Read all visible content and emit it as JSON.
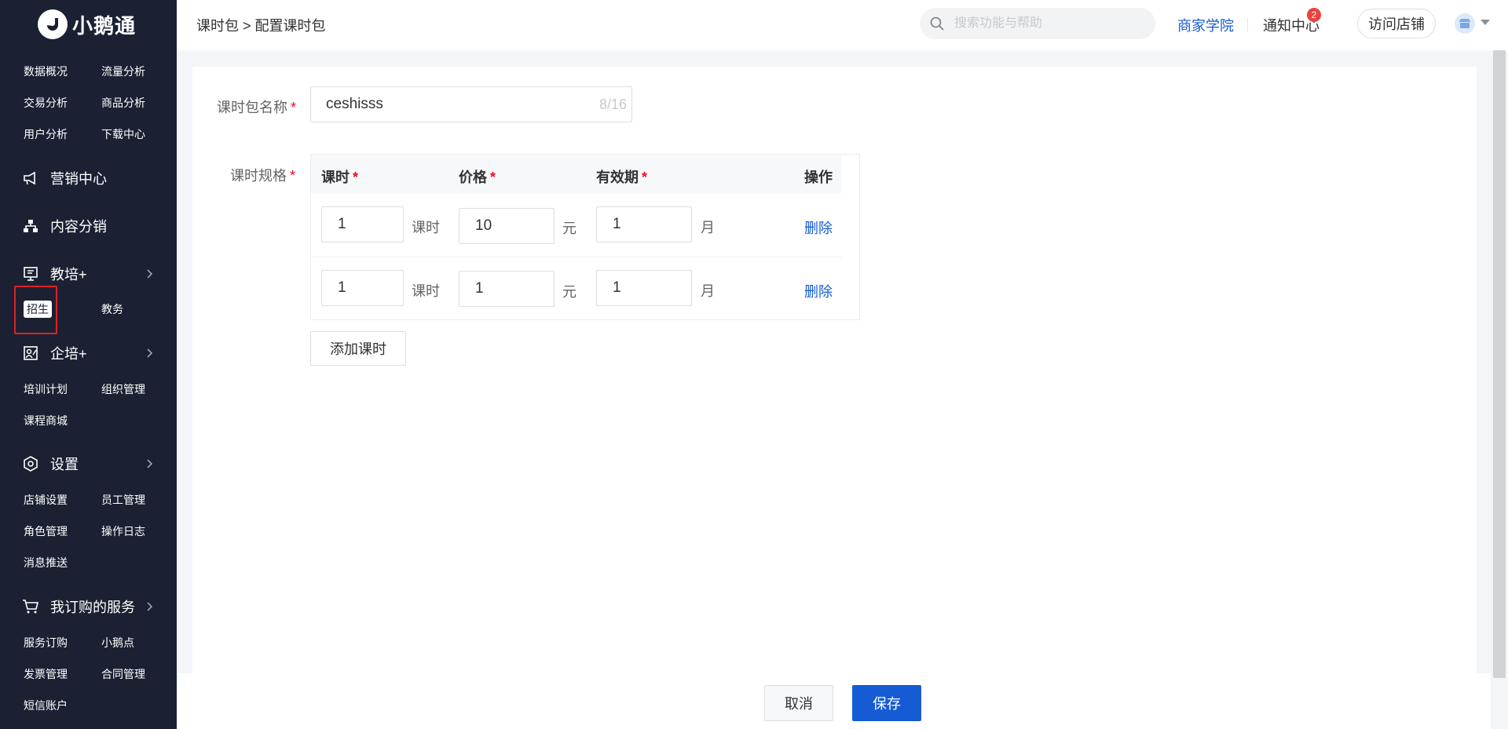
{
  "app": {
    "brand": "小鹅通"
  },
  "sidebar": {
    "data_items": [
      "数据概况",
      "流量分析",
      "交易分析",
      "商品分析",
      "用户分析",
      "下载中心"
    ],
    "marketing": {
      "label": "营销中心",
      "icon": "megaphone-icon"
    },
    "content_dist": {
      "label": "内容分销",
      "icon": "org-tree-icon"
    },
    "edu": {
      "label": "教培+",
      "icon": "board-icon",
      "items": [
        "招生",
        "教务"
      ],
      "active_item": "招生"
    },
    "corp": {
      "label": "企培+",
      "icon": "person-board-icon",
      "items": [
        "培训计划",
        "组织管理",
        "课程商城"
      ]
    },
    "settings": {
      "label": "设置",
      "icon": "gear-hex-icon",
      "items": [
        "店铺设置",
        "员工管理",
        "角色管理",
        "操作日志",
        "消息推送"
      ]
    },
    "services": {
      "label": "我订购的服务",
      "icon": "cart-icon",
      "items": [
        "服务订购",
        "小鹅点",
        "发票管理",
        "合同管理",
        "短信账户"
      ]
    }
  },
  "header": {
    "breadcrumb": "课时包 > 配置课时包",
    "search_placeholder": "搜索功能与帮助",
    "academy": "商家学院",
    "notices": "通知中心",
    "notice_count": "2",
    "visit_store": "访问店铺",
    "accent": "#155bd4"
  },
  "form": {
    "name_label": "课时包名称",
    "name_value": "ceshisss",
    "name_count": "8/16",
    "spec_label": "课时规格",
    "required_mark": "*",
    "columns": {
      "hours": "课时",
      "price": "价格",
      "validity": "有效期",
      "actions": "操作"
    },
    "units": {
      "hours": "课时",
      "price": "元",
      "validity": "月"
    },
    "rows": [
      {
        "hours": "1",
        "price": "10",
        "validity": "1",
        "action": "删除"
      },
      {
        "hours": "1",
        "price": "1",
        "validity": "1",
        "action": "删除"
      }
    ],
    "add_button": "添加课时"
  },
  "footer": {
    "cancel": "取消",
    "save": "保存"
  }
}
